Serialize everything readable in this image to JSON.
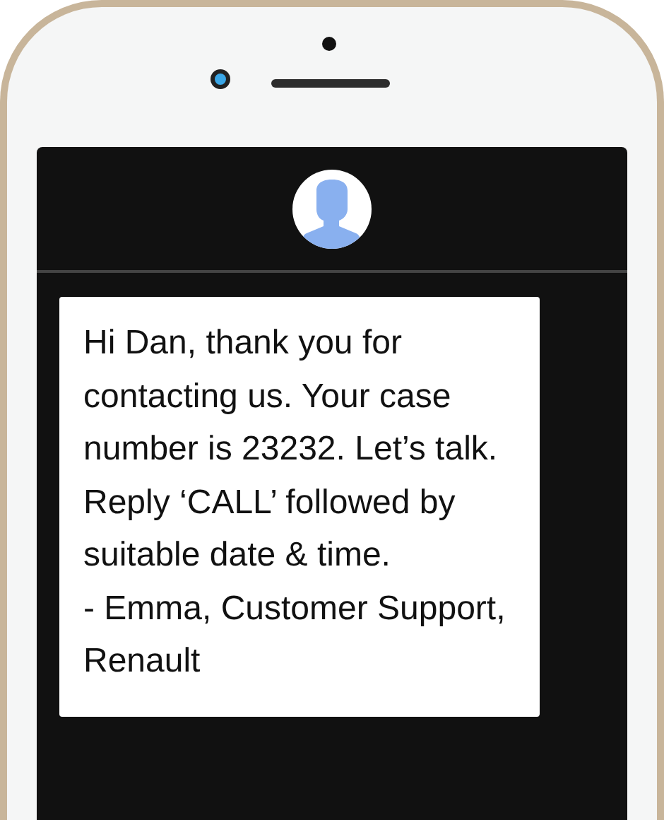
{
  "message": {
    "text": "Hi Dan, thank you for contacting us. Your case number is 23232. Let’s talk. Reply ‘CALL’ followed by suitable date & time.\n- Emma, Customer Support, Renault"
  }
}
